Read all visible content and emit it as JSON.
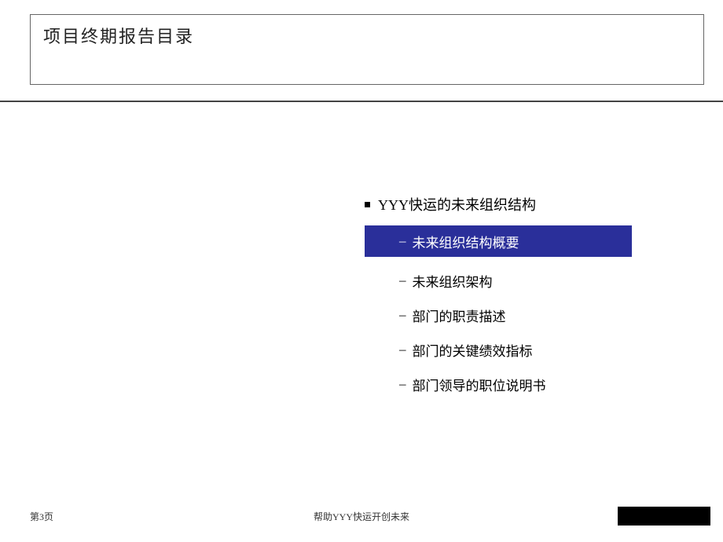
{
  "title": "项目终期报告目录",
  "section_heading": "YYY快运的未来组织结构",
  "items": [
    {
      "label": "未来组织结构概要",
      "highlight": true
    },
    {
      "label": "未来组织架构",
      "highlight": false
    },
    {
      "label": "部门的职责描述",
      "highlight": false
    },
    {
      "label": "部门的关键绩效指标",
      "highlight": false
    },
    {
      "label": "部门领导的职位说明书",
      "highlight": false
    }
  ],
  "footer": {
    "page": "第3页",
    "center": "帮助YYY快运开创未来"
  }
}
